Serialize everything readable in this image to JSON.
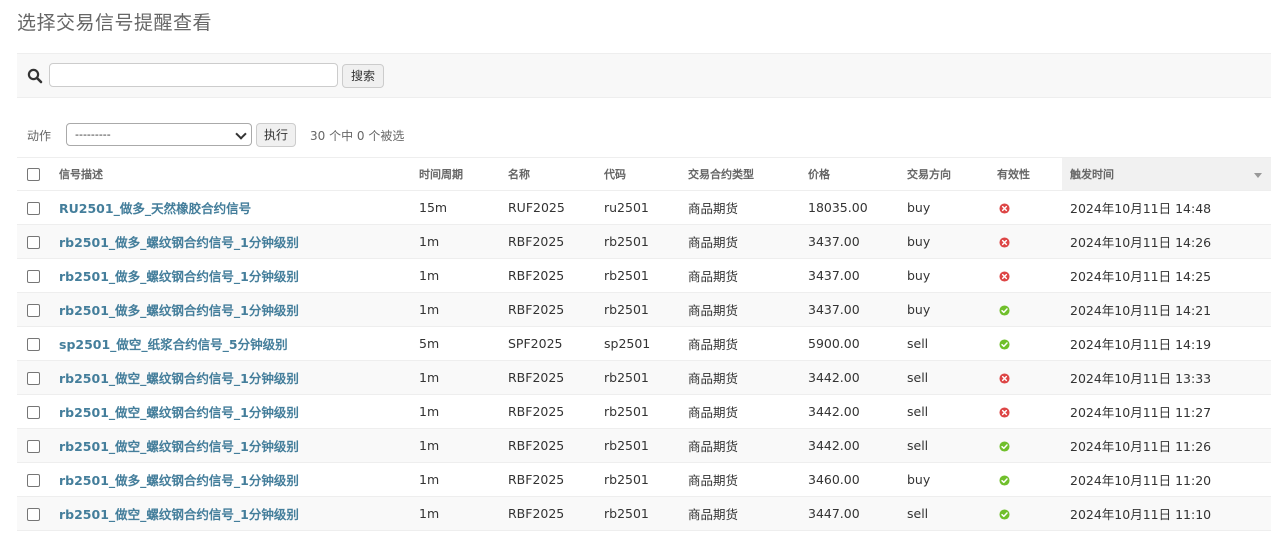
{
  "page": {
    "title": "选择交易信号提醒查看"
  },
  "search": {
    "value": "",
    "placeholder": "",
    "button_label": "搜索"
  },
  "actions": {
    "label": "动作",
    "select_value": "---------",
    "go_label": "执行",
    "selected_count": "30 个中 0 个被选"
  },
  "table": {
    "headers": [
      "信号描述",
      "时间周期",
      "名称",
      "代码",
      "交易合约类型",
      "价格",
      "交易方向",
      "有效性",
      "触发时间"
    ],
    "sorted_column": "触发时间",
    "rows": [
      {
        "desc": "RU2501_做多_天然橡胶合约信号",
        "period": "15m",
        "name": "RUF2025",
        "code": "ru2501",
        "type": "商品期货",
        "price": "18035.00",
        "direction": "buy",
        "valid": false,
        "time": "2024年10月11日 14:48"
      },
      {
        "desc": "rb2501_做多_螺纹钢合约信号_1分钟级别",
        "period": "1m",
        "name": "RBF2025",
        "code": "rb2501",
        "type": "商品期货",
        "price": "3437.00",
        "direction": "buy",
        "valid": false,
        "time": "2024年10月11日 14:26"
      },
      {
        "desc": "rb2501_做多_螺纹钢合约信号_1分钟级别",
        "period": "1m",
        "name": "RBF2025",
        "code": "rb2501",
        "type": "商品期货",
        "price": "3437.00",
        "direction": "buy",
        "valid": false,
        "time": "2024年10月11日 14:25"
      },
      {
        "desc": "rb2501_做多_螺纹钢合约信号_1分钟级别",
        "period": "1m",
        "name": "RBF2025",
        "code": "rb2501",
        "type": "商品期货",
        "price": "3437.00",
        "direction": "buy",
        "valid": true,
        "time": "2024年10月11日 14:21"
      },
      {
        "desc": "sp2501_做空_纸浆合约信号_5分钟级别",
        "period": "5m",
        "name": "SPF2025",
        "code": "sp2501",
        "type": "商品期货",
        "price": "5900.00",
        "direction": "sell",
        "valid": true,
        "time": "2024年10月11日 14:19"
      },
      {
        "desc": "rb2501_做空_螺纹钢合约信号_1分钟级别",
        "period": "1m",
        "name": "RBF2025",
        "code": "rb2501",
        "type": "商品期货",
        "price": "3442.00",
        "direction": "sell",
        "valid": false,
        "time": "2024年10月11日 13:33"
      },
      {
        "desc": "rb2501_做空_螺纹钢合约信号_1分钟级别",
        "period": "1m",
        "name": "RBF2025",
        "code": "rb2501",
        "type": "商品期货",
        "price": "3442.00",
        "direction": "sell",
        "valid": false,
        "time": "2024年10月11日 11:27"
      },
      {
        "desc": "rb2501_做空_螺纹钢合约信号_1分钟级别",
        "period": "1m",
        "name": "RBF2025",
        "code": "rb2501",
        "type": "商品期货",
        "price": "3442.00",
        "direction": "sell",
        "valid": true,
        "time": "2024年10月11日 11:26"
      },
      {
        "desc": "rb2501_做多_螺纹钢合约信号_1分钟级别",
        "period": "1m",
        "name": "RBF2025",
        "code": "rb2501",
        "type": "商品期货",
        "price": "3460.00",
        "direction": "buy",
        "valid": true,
        "time": "2024年10月11日 11:20"
      },
      {
        "desc": "rb2501_做空_螺纹钢合约信号_1分钟级别",
        "period": "1m",
        "name": "RBF2025",
        "code": "rb2501",
        "type": "商品期货",
        "price": "3447.00",
        "direction": "sell",
        "valid": true,
        "time": "2024年10月11日 11:10"
      }
    ]
  },
  "colors": {
    "link": "#447e9b",
    "valid": "#70bf2b",
    "invalid": "#dd4646"
  },
  "icons": {
    "search": "search-icon",
    "valid": "check-circle-icon",
    "invalid": "x-circle-icon"
  }
}
